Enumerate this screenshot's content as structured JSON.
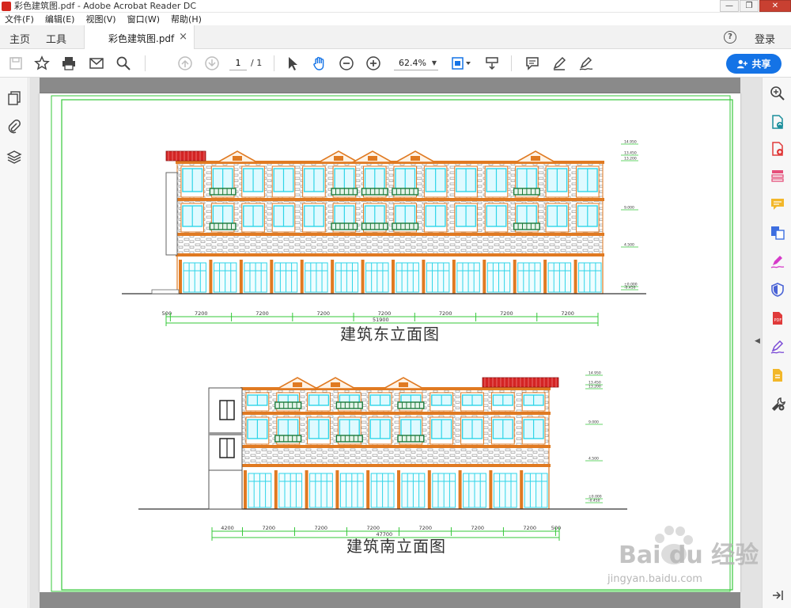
{
  "window": {
    "title": "彩色建筑图.pdf - Adobe Acrobat Reader DC",
    "buttons": [
      "—",
      "❐",
      "✕"
    ]
  },
  "menu": {
    "items": [
      "文件(F)",
      "编辑(E)",
      "视图(V)",
      "窗口(W)",
      "帮助(H)"
    ]
  },
  "tabs": {
    "home": "主页",
    "tools": "工具",
    "document": "彩色建筑图.pdf",
    "close": "×",
    "help": "?",
    "login": "登录"
  },
  "toolbar": {
    "page_current": "1",
    "page_total": "/ 1",
    "zoom": "62.4%",
    "share": "共享",
    "icons": [
      "save-icon",
      "bookmark-star-icon",
      "print-icon",
      "email-icon",
      "search-icon",
      "prev-page-icon",
      "next-page-icon",
      "select-cursor-icon",
      "hand-tool-icon",
      "zoom-out-icon",
      "zoom-in-icon",
      "fit-page-icon",
      "scroll-mode-icon",
      "comment-icon",
      "highlight-pen-icon",
      "sign-icon"
    ]
  },
  "left_panel": {
    "icons": [
      "pages-thumbnail-icon",
      "attachment-icon",
      "layers-icon"
    ]
  },
  "right_panel": {
    "icons": [
      "enhance-scan-icon",
      "export-pdf-icon",
      "create-pdf-icon",
      "organize-pages-icon",
      "comment-tool-icon",
      "combine-files-icon",
      "fill-sign-icon",
      "protect-icon",
      "pdf-file-icon",
      "edit-pdf-icon",
      "send-track-icon",
      "more-tools-icon",
      "collapse-panel-icon"
    ]
  },
  "drawing": {
    "east_title": "建筑东立面图",
    "south_title": "建筑南立面图",
    "east_dims": [
      "500",
      "7200",
      "7200",
      "7200",
      "7200",
      "7200",
      "7200",
      "7200"
    ],
    "east_total": "51900",
    "south_dims": [
      "4200",
      "7200",
      "7200",
      "7200",
      "7200",
      "7200",
      "7200",
      "500"
    ],
    "south_total": "47700",
    "east_levels": [
      "14.950",
      "13.450",
      "13.200",
      "9.000",
      "4.500",
      "±0.000",
      "-0.450"
    ],
    "south_levels": [
      "14.950",
      "13.450",
      "13.200",
      "9.000",
      "4.500",
      "±0.000",
      "-0.450"
    ]
  },
  "watermark": {
    "text": "Bai du 经验",
    "sub": "jingyan.baidu.com"
  },
  "colors": {
    "accent": "#1473e6",
    "drawing_frame": "#35c83a",
    "facade_orange": "#e07a22",
    "glass_cyan": "#2fd5e8",
    "roof_red": "#d42424",
    "railing_green": "#1a7a3a"
  }
}
